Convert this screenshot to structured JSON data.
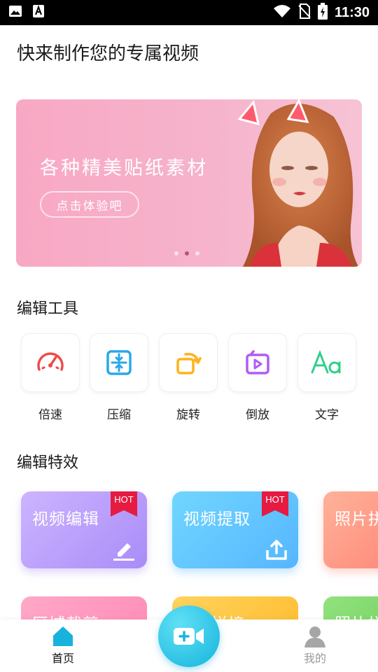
{
  "status_bar": {
    "time": "11:30",
    "icons": [
      "image-icon",
      "font-icon",
      "wifi-icon",
      "no-sim-icon",
      "battery-charging-icon"
    ]
  },
  "page_title": "快来制作您的专属视频",
  "banner": {
    "headline": "各种精美贴纸素材",
    "cta": "点击体验吧",
    "dots": 3,
    "active_dot": 2
  },
  "tools": {
    "title": "编辑工具",
    "items": [
      {
        "label": "倍速",
        "icon": "speedometer-icon",
        "color": "#f04a4a"
      },
      {
        "label": "压缩",
        "icon": "compress-icon",
        "color": "#2aa7e8"
      },
      {
        "label": "旋转",
        "icon": "rotate-icon",
        "color": "#ffb21a"
      },
      {
        "label": "倒放",
        "icon": "reverse-play-icon",
        "color": "#b15cf3"
      },
      {
        "label": "文字",
        "icon": "text-aa-icon",
        "color": "#2fd08a"
      }
    ]
  },
  "effects": {
    "title": "编辑特效",
    "hot_label": "HOT",
    "row1": [
      {
        "title": "视频编辑",
        "hot": true,
        "icon": "pencil-icon",
        "gradient": [
          "#c9b1ff",
          "#a98cf8"
        ]
      },
      {
        "title": "视频提取",
        "hot": true,
        "icon": "upload-icon",
        "gradient": [
          "#6fd3ff",
          "#58b8ff"
        ]
      },
      {
        "title": "照片拼",
        "hot": false,
        "icon": "",
        "gradient": [
          "#ffb29a",
          "#ff8a7a"
        ]
      }
    ],
    "row2": [
      {
        "title": "区域裁剪",
        "gradient": [
          "#ffa3c4",
          "#ff86b3"
        ]
      },
      {
        "title": "拼接",
        "gradient": [
          "#ffd15a",
          "#ffba2c"
        ]
      },
      {
        "title": "照片拼",
        "gradient": [
          "#8ee07a",
          "#6fcf5b"
        ]
      }
    ]
  },
  "bottom_nav": {
    "home": "首页",
    "mine": "我的",
    "active_color": "#17b3dc",
    "inactive_color": "#9a9a9a"
  }
}
